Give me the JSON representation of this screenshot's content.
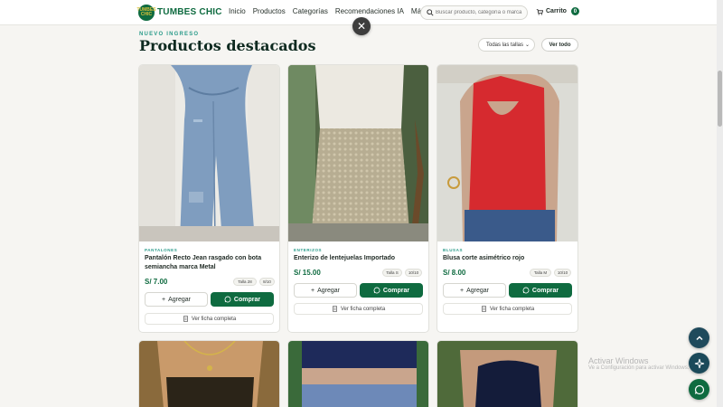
{
  "header": {
    "logo_text": "TUMBES CHIC",
    "brand": "TUMBES CHIC",
    "nav": [
      "Inicio",
      "Productos",
      "Categorías",
      "Recomendaciones IA",
      "Más"
    ],
    "search_placeholder": "Buscar producto, categoría o marca",
    "cart_label": "Carrito",
    "cart_count": "0"
  },
  "overlay": {
    "close_symbol": "✕"
  },
  "section": {
    "eyebrow": "NUEVO INGRESO",
    "title": "Productos destacados",
    "size_filter": "Todas las tallas",
    "view_all": "Ver todo"
  },
  "products": [
    {
      "category": "PANTALONES",
      "name": "Pantalón Recto Jean rasgado con bota semiancha marca Metal",
      "price": "S/ 7.00",
      "size": "Talla 28",
      "condition": "8/10",
      "add_label": "Agregar",
      "buy_label": "Comprar",
      "sheet_label": "Ver ficha completa"
    },
    {
      "category": "ENTERIZOS",
      "name": "Enterizo de lentejuelas Importado",
      "price": "S/ 15.00",
      "size": "Talla S",
      "condition": "10/10",
      "add_label": "Agregar",
      "buy_label": "Comprar",
      "sheet_label": "Ver ficha completa"
    },
    {
      "category": "BLUSAS",
      "name": "Blusa corte asimétrico rojo",
      "price": "S/ 8.00",
      "size": "Talla M",
      "condition": "10/10",
      "add_label": "Agregar",
      "buy_label": "Comprar",
      "sheet_label": "Ver ficha completa"
    }
  ],
  "watermark": {
    "line1": "Activar Windows",
    "line2": "Ve a Configuración para activar Windows."
  },
  "colors": {
    "brand_green": "#0f6b40",
    "accent_teal": "#2a9b8a",
    "whatsapp_green": "#0f6b40",
    "fab_dark": "#1b4a5a"
  },
  "icons": [
    "search-icon",
    "cart-icon",
    "close-icon",
    "plus-icon",
    "whatsapp-icon",
    "document-icon",
    "chevron-up-icon",
    "sparkle-icon",
    "chevron-down-icon"
  ]
}
